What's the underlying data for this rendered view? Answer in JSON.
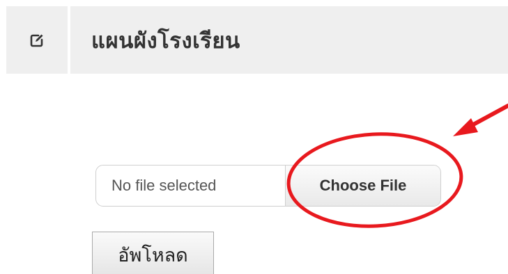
{
  "header": {
    "title": "แผนผังโรงเรียน",
    "icon": "edit-icon"
  },
  "file_input": {
    "status_text": "No file selected",
    "choose_label": "Choose File"
  },
  "upload": {
    "label": "อัพโหลด"
  },
  "colors": {
    "header_bg": "#efefef",
    "annotation_red": "#e8191e"
  }
}
